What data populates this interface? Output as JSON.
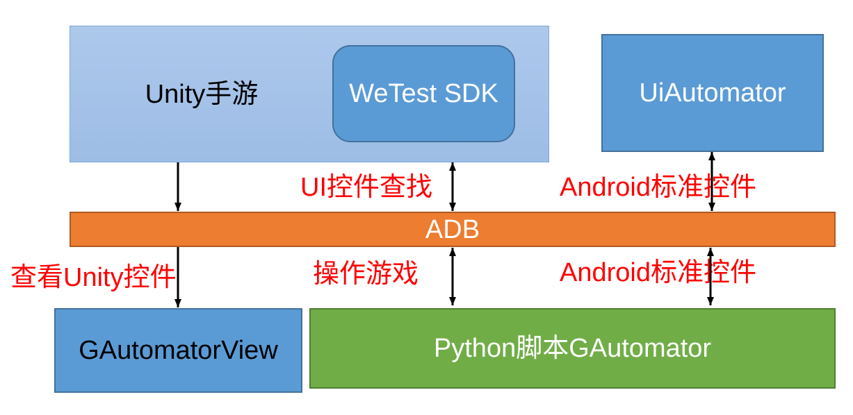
{
  "boxes": {
    "unity_game": {
      "label": "Unity手游"
    },
    "wetest_sdk": {
      "label": "WeTest SDK"
    },
    "uiautomator": {
      "label": "UiAutomator"
    },
    "adb": {
      "label": "ADB"
    },
    "gautomator_view": {
      "label": "GAutomatorView"
    },
    "python_gautomator": {
      "label": "Python脚本GAutomator"
    }
  },
  "edge_labels": {
    "ui_control_find": "UI控件查找",
    "android_std_top": "Android标准控件",
    "view_unity_controls": "查看Unity控件",
    "operate_game": "操作游戏",
    "android_std_bottom": "Android标准控件"
  },
  "colors": {
    "unity_box": "#a6c4e8",
    "blue_box": "#5b9bd5",
    "adb_bar": "#ed7d31",
    "python_box": "#70ad47",
    "edge_label": "#ff0000",
    "arrow": "#000000"
  }
}
